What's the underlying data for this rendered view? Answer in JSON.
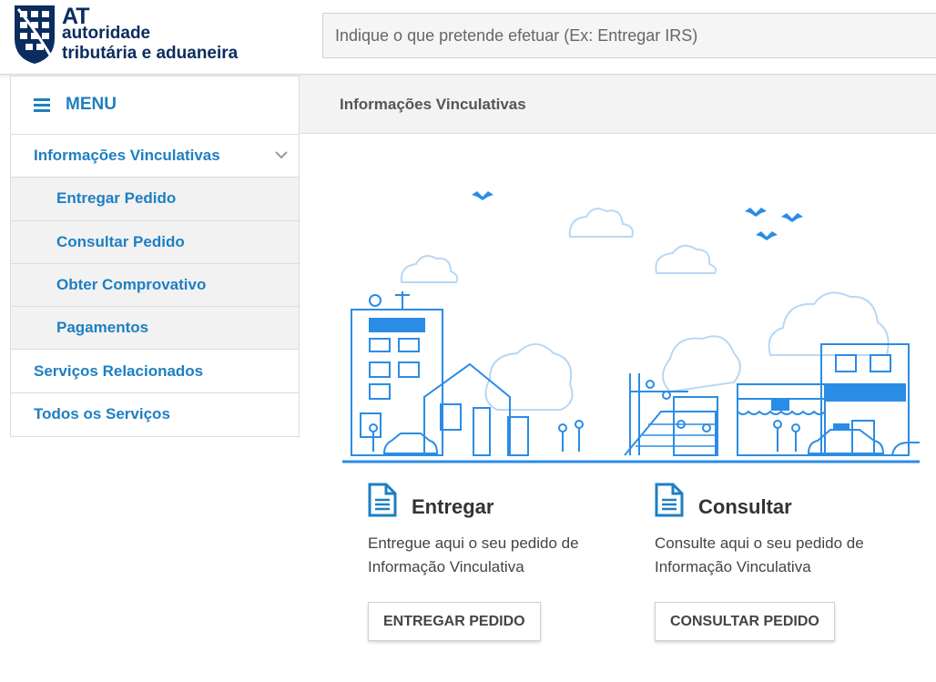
{
  "header": {
    "logo": {
      "line1": "AT",
      "line2": "autoridade",
      "line3": "tributária e aduaneira"
    },
    "search_placeholder": "Indique o que pretende efetuar (Ex: Entregar IRS)"
  },
  "menu": {
    "title": "MENU",
    "items": [
      {
        "label": "Informações Vinculativas",
        "level": "top",
        "expanded": true
      },
      {
        "label": "Entregar Pedido",
        "level": "sub"
      },
      {
        "label": "Consultar Pedido",
        "level": "sub"
      },
      {
        "label": "Obter Comprovativo",
        "level": "sub"
      },
      {
        "label": "Pagamentos",
        "level": "sub"
      },
      {
        "label": "Serviços Relacionados",
        "level": "top"
      },
      {
        "label": "Todos os Serviços",
        "level": "top"
      }
    ]
  },
  "breadcrumb": "Informações Vinculativas",
  "cards": {
    "entregar": {
      "title": "Entregar",
      "description": "Entregue aqui o seu pedido de Informação Vinculativa",
      "button": "ENTREGAR PEDIDO"
    },
    "consultar": {
      "title": "Consultar",
      "description": "Consulte aqui o seu pedido de Informação Vinculativa",
      "button": "CONSULTAR PEDIDO"
    }
  },
  "colors": {
    "accent": "#1e7fc2",
    "brand": "#0b2c5f",
    "illustration": "#2b8ce6"
  }
}
